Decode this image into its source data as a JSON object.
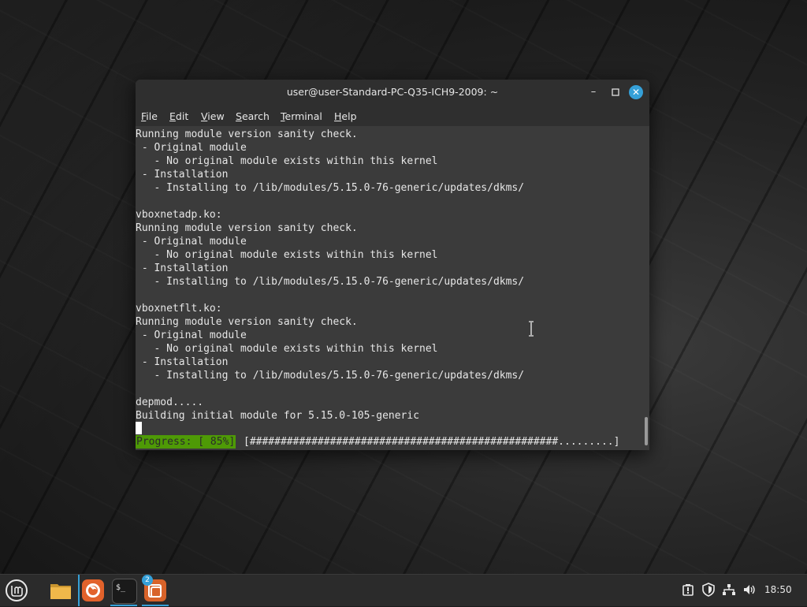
{
  "window": {
    "title": "user@user-Standard-PC-Q35-ICH9-2009: ~",
    "controls": {
      "minimize": "–",
      "maximize": "□",
      "close": "✕"
    }
  },
  "menubar": {
    "items": [
      {
        "label": "File",
        "key": "F"
      },
      {
        "label": "Edit",
        "key": "E"
      },
      {
        "label": "View",
        "key": "V"
      },
      {
        "label": "Search",
        "key": "S"
      },
      {
        "label": "Terminal",
        "key": "T"
      },
      {
        "label": "Help",
        "key": "H"
      }
    ]
  },
  "terminal": {
    "lines": [
      "Running module version sanity check.",
      " - Original module",
      "   - No original module exists within this kernel",
      " - Installation",
      "   - Installing to /lib/modules/5.15.0-76-generic/updates/dkms/",
      "",
      "vboxnetadp.ko:",
      "Running module version sanity check.",
      " - Original module",
      "   - No original module exists within this kernel",
      " - Installation",
      "   - Installing to /lib/modules/5.15.0-76-generic/updates/dkms/",
      "",
      "vboxnetflt.ko:",
      "Running module version sanity check.",
      " - Original module",
      "   - No original module exists within this kernel",
      " - Installation",
      "   - Installing to /lib/modules/5.15.0-76-generic/updates/dkms/",
      "",
      "depmod.....",
      "Building initial module for 5.15.0-105-generic"
    ],
    "progress_label": "Progress: [ 85%]",
    "progress_bar": "[##################################################.........]",
    "progress_percent": 85,
    "progress_color": "#4e9a06"
  },
  "taskbar": {
    "apps": [
      {
        "name": "menu-icon"
      },
      {
        "name": "files-icon"
      },
      {
        "name": "firefox-icon"
      },
      {
        "name": "terminal-icon",
        "active": true
      },
      {
        "name": "software-updater-icon",
        "badge": "2",
        "active": true
      }
    ],
    "terminal_glyph": "$_",
    "tray": [
      "notifications-icon",
      "shield-icon",
      "network-icon",
      "volume-icon"
    ],
    "clock": "18:50"
  }
}
